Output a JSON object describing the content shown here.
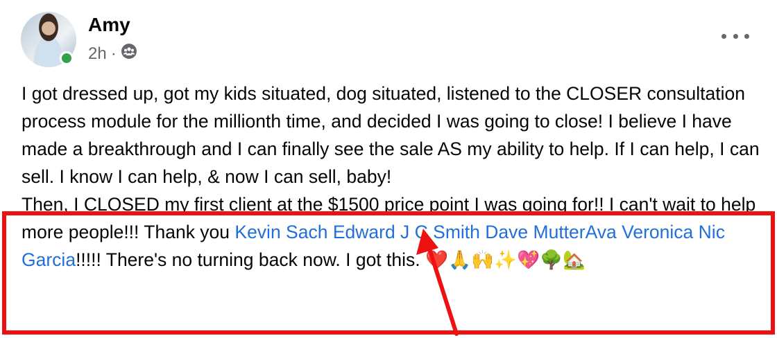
{
  "post": {
    "author": "Amy",
    "time": "2h",
    "separator": "·",
    "audience_icon": "friends-icon",
    "more_icon": "more-options-icon",
    "paragraph1": "I got dressed up, got my kids situated, dog situated, listened to the CLOSER consultation process module for the millionth time, and decided I was going to close!  I believe I have made a breakthrough and I can finally see the sale AS my ability to help. If I can help, I can sell. I know I can help, & now I can sell, baby!",
    "paragraph2_start": "Then, I CLOSED my first client at the $1500 price point I was going for!! I can't wait to help more people!!! Thank you ",
    "mentions": [
      "Kevin Sach",
      "Edward J C Smith",
      "Dave Mutter",
      "Ava Veronica",
      "Nic Garcia"
    ],
    "mention_separators": [
      " ",
      " ",
      "",
      " ",
      ""
    ],
    "paragraph2_end": "!!!!! There's no turning back now. I got this. ",
    "emojis": "❤️🙏🙌✨💖🌳🏡"
  },
  "annotation": {
    "color": "#ee1111"
  }
}
